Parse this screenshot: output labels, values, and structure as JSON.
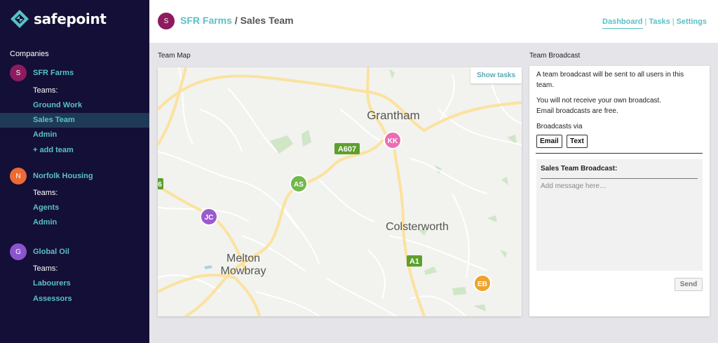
{
  "brand": {
    "name": "safepoint",
    "accent": "#59c1c6"
  },
  "sidebar": {
    "companies_label": "Companies",
    "companies": [
      {
        "initial": "S",
        "name": "SFR Farms",
        "color": "#8e1a5f",
        "teams_label": "Teams:",
        "teams": [
          "Ground Work",
          "Sales Team",
          "Admin",
          "+ add team"
        ]
      },
      {
        "initial": "N",
        "name": "Norfolk Housing",
        "color": "#ec6a34",
        "teams_label": "Teams:",
        "teams": [
          "Agents",
          "Admin"
        ]
      },
      {
        "initial": "G",
        "name": "Global Oil",
        "color": "#8c54cc",
        "teams_label": "Teams:",
        "teams": [
          "Labourers",
          "Assessors"
        ]
      }
    ],
    "active_team": "Sales Team"
  },
  "header": {
    "avatar_initial": "S",
    "company": "SFR Farms",
    "separator": "/",
    "team": "Sales Team",
    "nav": [
      "Dashboard",
      "Tasks",
      "Settings"
    ],
    "nav_sep": "|",
    "active_nav": "Dashboard"
  },
  "map": {
    "title": "Team Map",
    "show_tasks": "Show tasks",
    "places": [
      "Grantham",
      "Colsterworth",
      "Melton",
      "Mowbray"
    ],
    "road_labels": [
      "A607",
      "A1",
      "6"
    ],
    "markers": [
      {
        "initials": "KK",
        "color": "#e96fb2"
      },
      {
        "initials": "AS",
        "color": "#72b84a"
      },
      {
        "initials": "JC",
        "color": "#9b59d0"
      },
      {
        "initials": "EB",
        "color": "#f0a22a"
      }
    ]
  },
  "broadcast": {
    "title": "Team Broadcast",
    "line1": "A team broadcast will be sent to all users in this team.",
    "line2": "You will not receive your own broadcast.",
    "line3": "Email broadcasts are free.",
    "via_label": "Broadcasts via",
    "email_btn": "Email",
    "text_btn": "Text",
    "box_title": "Sales Team Broadcast:",
    "placeholder": "Add message here…",
    "send": "Send"
  }
}
